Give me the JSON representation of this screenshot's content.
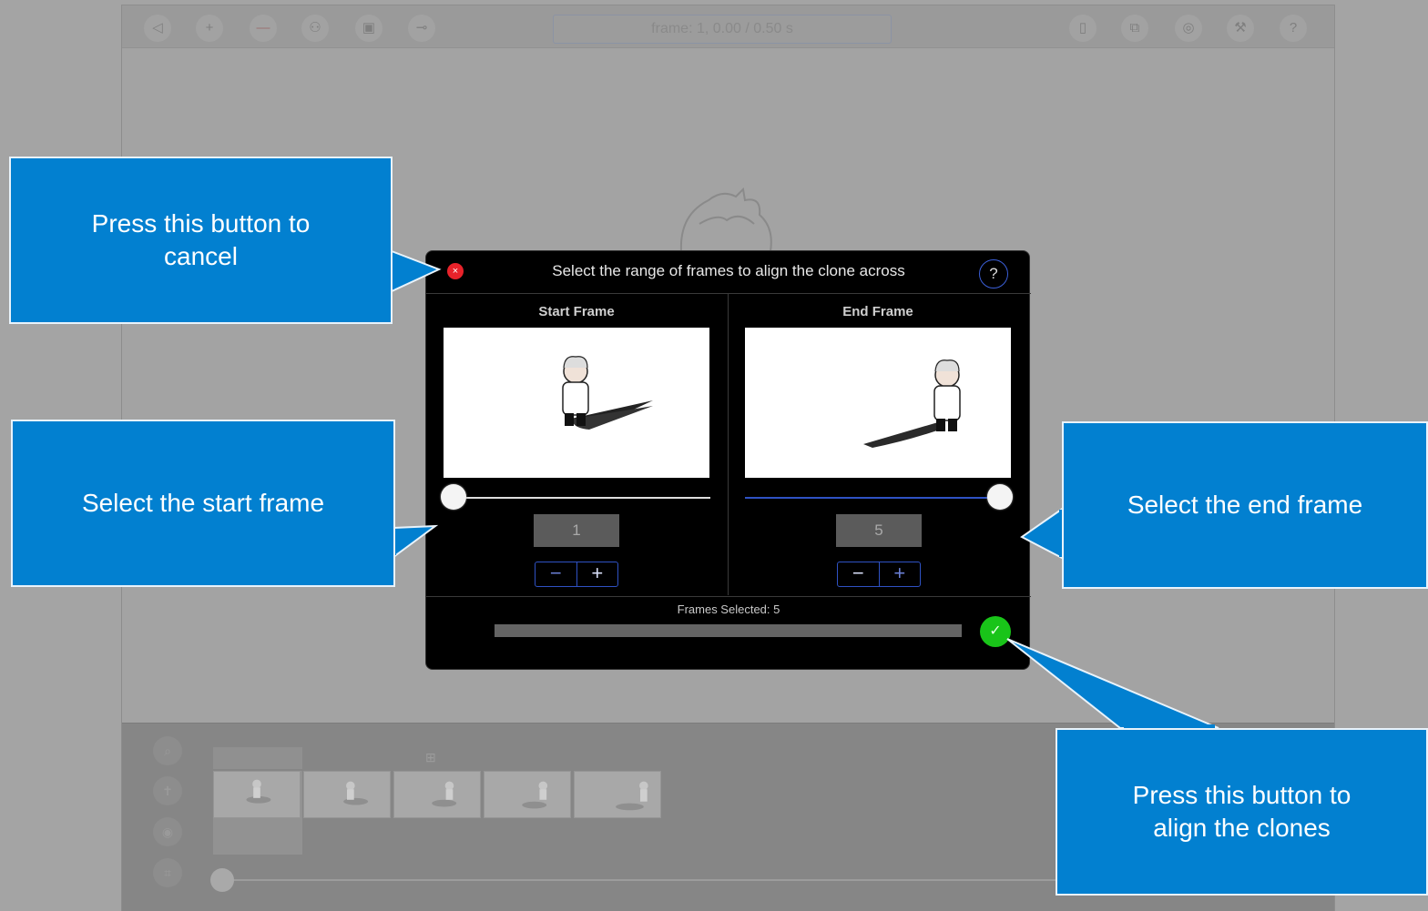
{
  "toolbar": {
    "frame_display": "frame: 1, 0.00 / 0.50 s",
    "left_icons": [
      "back-icon",
      "add-icon",
      "remove-icon",
      "camera-icon",
      "photo-icon",
      "key-icon"
    ],
    "right_icons": [
      "clipboard-icon",
      "export-icon",
      "settings-icon",
      "wrench-icon",
      "help-icon"
    ],
    "left_glyphs": [
      "◁",
      "+",
      "—",
      "⚇",
      "▣",
      "⊸"
    ],
    "right_glyphs": [
      "▯",
      "⧉",
      "◎",
      "⚒",
      "?"
    ]
  },
  "dialog": {
    "title": "Select the range of frames to align the clone across",
    "close_glyph": "×",
    "help_glyph": "?",
    "start": {
      "label": "Start Frame",
      "value": "1",
      "slider_fraction": 0.0
    },
    "end": {
      "label": "End Frame",
      "value": "5",
      "slider_fraction": 1.0
    },
    "minus_glyph": "−",
    "plus_glyph": "+",
    "frames_selected": "Frames Selected: 5",
    "confirm_glyph": "✓"
  },
  "callouts": {
    "cancel": "Press this button to cancel",
    "start": "Select the start frame",
    "end": "Select the end frame",
    "align": "Press this button to align the clones"
  },
  "timeline": {
    "side_icons": [
      "zoom-icon",
      "figure-icon",
      "pin-icon",
      "crop-icon"
    ],
    "side_glyphs": [
      "⌕",
      "✝",
      "◉",
      "⌗"
    ],
    "frame_count": 5
  },
  "colors": {
    "callout_blue": "#0280d0",
    "cancel_red": "#e8222a",
    "confirm_green": "#19c419",
    "accent_blue": "#2f52c4"
  }
}
